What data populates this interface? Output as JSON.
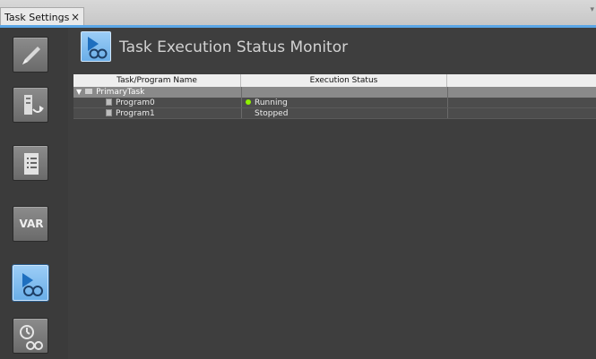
{
  "tab": {
    "title": "Task Settings",
    "close_glyph": "×"
  },
  "sidebar": {
    "items": [
      {
        "name": "pencil-icon"
      },
      {
        "name": "task-flow-icon"
      },
      {
        "name": "list-icon"
      },
      {
        "name": "var-icon",
        "label": "VAR"
      },
      {
        "name": "monitor-icon",
        "active": true
      },
      {
        "name": "clock-monitor-icon"
      }
    ]
  },
  "header": {
    "title": "Task Execution Status Monitor"
  },
  "table": {
    "columns": [
      "Task/Program Name",
      "Execution Status",
      ""
    ],
    "rows": [
      {
        "type": "group",
        "name": "PrimaryTask",
        "status": ""
      },
      {
        "type": "program",
        "name": "Program0",
        "status": "Running",
        "status_color": "#8ff000"
      },
      {
        "type": "program",
        "name": "Program1",
        "status": "Stopped"
      }
    ]
  },
  "colors": {
    "accent": "#5ba6e6",
    "background": "#3e3e3e",
    "running": "#8ff000"
  }
}
